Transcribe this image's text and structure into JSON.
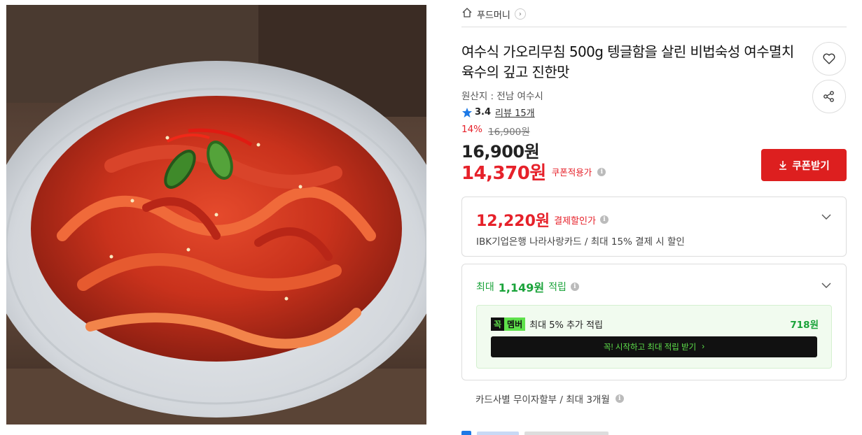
{
  "store": {
    "name": "푸드머니",
    "chevron": "›"
  },
  "product": {
    "title": "여수식 가오리무침 500g 텡글함을 살린 비법숙성 여수멸치육수의 깊고 진한맛",
    "origin": "원산지 : 전남 여수시",
    "rating": "3.4",
    "reviews": "리뷰 15개",
    "discount_pct": "14%",
    "original_price": "16,900원",
    "price": "16,900원",
    "coupon_price": "14,370원",
    "coupon_label": "쿠폰적용가"
  },
  "coupon_button": {
    "label": "쿠폰받기"
  },
  "payment_discount": {
    "price": "12,220원",
    "label": "결제할인가",
    "desc": "IBK기업은행 나라사랑카드 / 최대 15% 결제 시 할인"
  },
  "points": {
    "prefix": "최대",
    "amount": "1,149원",
    "suffix": "적립",
    "member_badge_a": "꼭",
    "member_badge_b": "멤버",
    "member_text": "최대 5% 추가 적립",
    "member_amount": "718원",
    "member_button": "꼭! 시작하고 최대 적립 받기",
    "member_button_chevron": "›"
  },
  "installment": "카드사별 무이자할부 / 최대 3개월",
  "icons": {
    "home": "home-icon",
    "heart": "heart-icon",
    "share": "share-icon",
    "star": "star-icon",
    "download": "download-icon",
    "info": "info-icon",
    "chevron": "chevron-down-icon"
  },
  "colors": {
    "accent_red": "#e6212a",
    "coupon_button": "#dd1f1f",
    "point_green": "#1aa33a",
    "member_green": "#5ee14b",
    "star_blue": "#1d79e6"
  }
}
